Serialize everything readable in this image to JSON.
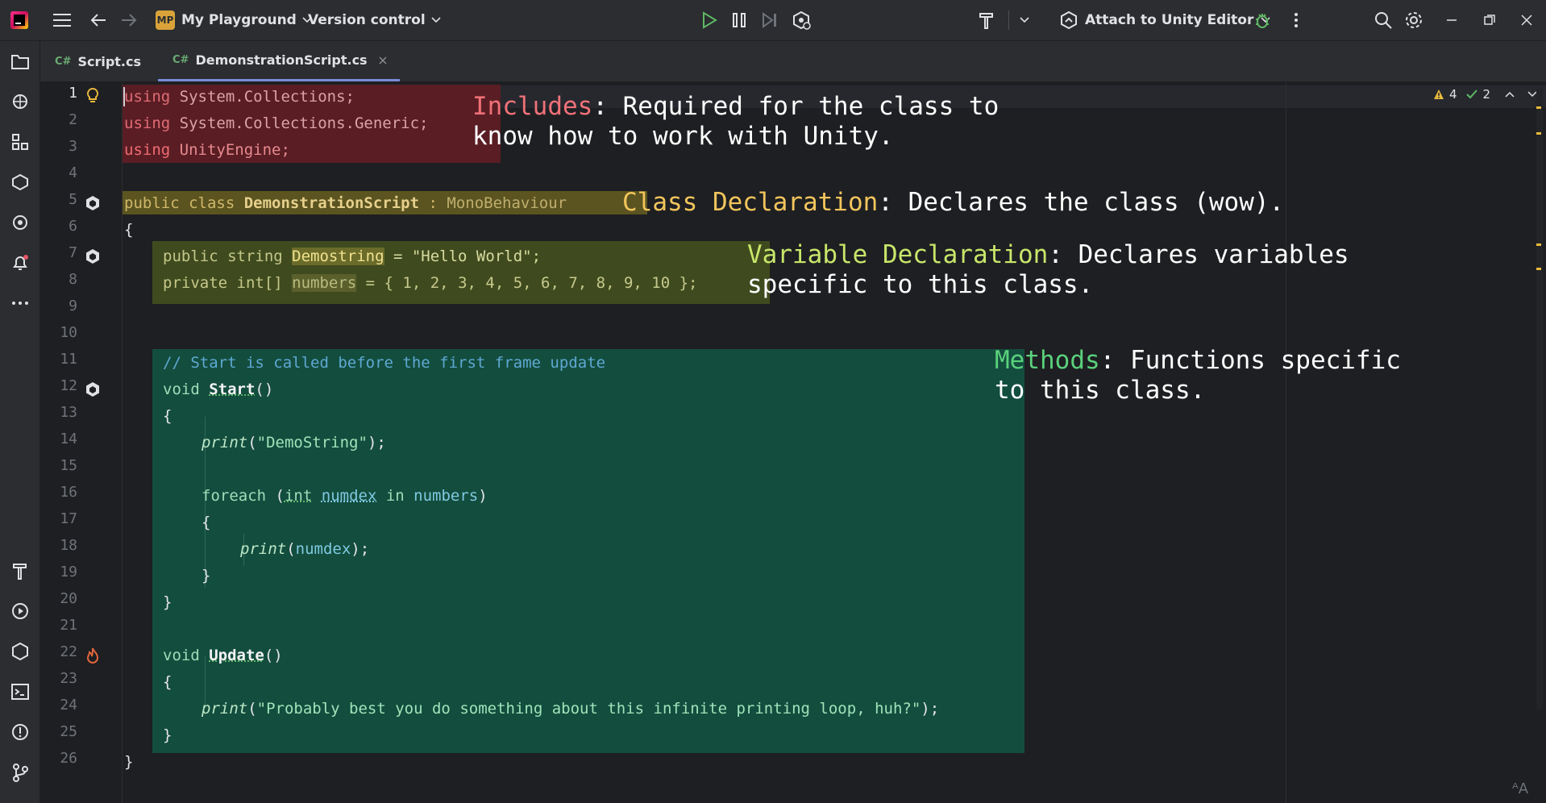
{
  "titlebar": {
    "project_badge": "MP",
    "project_name": "My Playground",
    "vcs_label": "Version control",
    "run_config": "Attach to Unity Editor"
  },
  "tabs": [
    {
      "type": "C#",
      "label": "Script.cs"
    },
    {
      "type": "C#",
      "label": "DemonstrationScript.cs"
    }
  ],
  "inspections": {
    "warnings": "4",
    "ok": "2"
  },
  "line_numbers": [
    "1",
    "2",
    "3",
    "4",
    "5",
    "6",
    "7",
    "8",
    "9",
    "10",
    "11",
    "12",
    "13",
    "14",
    "15",
    "16",
    "17",
    "18",
    "19",
    "20",
    "21",
    "22",
    "23",
    "24",
    "25",
    "26"
  ],
  "code": {
    "l1": {
      "kw": "using",
      "rest": " System.Collections;"
    },
    "l2": {
      "kw": "using",
      "rest": " System.Collections.Generic;"
    },
    "l3": {
      "kw": "using",
      "rest": " UnityEngine;"
    },
    "l5": {
      "a": "public class ",
      "name": "DemonstrationScript",
      "b": " : ",
      "base": "MonoBehaviour"
    },
    "l6": "{",
    "l7": {
      "a": "public string ",
      "var": "Demostring",
      "b": " = \"Hello World\";"
    },
    "l8": {
      "a": "private int[] ",
      "var": "numbers",
      "b": " = { 1, 2, 3, 4, 5, 6, 7, 8, 9, 10 };"
    },
    "l11": "// Start is called before the first frame update",
    "l12": {
      "kw": "void ",
      "name": "Start",
      "rest": "()"
    },
    "l13": "{",
    "l14": {
      "fn": "print",
      "a": "(",
      "str": "\"DemoString\"",
      "b": ");"
    },
    "l16": {
      "kw": "foreach ",
      "p1": "(",
      "t": "int",
      "sp": " ",
      "v": "numdex",
      "in": " in ",
      "col": "numbers",
      "p2": ")"
    },
    "l17": "{",
    "l18": {
      "fn": "print",
      "a": "(",
      "v": "numdex",
      "b": ");"
    },
    "l19": "}",
    "l20": "}",
    "l22": {
      "kw": "void ",
      "name": "Update",
      "rest": "()"
    },
    "l23": "{",
    "l24": {
      "fn": "print",
      "a": "(",
      "str": "\"Probably best you do something about this infinite printing loop, huh?\"",
      "b": ");"
    },
    "l25": "}",
    "l26": "}"
  },
  "annotations": {
    "includes": {
      "title": "Includes",
      "line1": ": Required for the class to",
      "line2": "know how to work with Unity."
    },
    "class_decl": {
      "title": "Class Declaration",
      "text": ": Declares the class (wow)."
    },
    "var_decl": {
      "title": "Variable Declaration",
      "line1": ": Declares variables",
      "line2": "specific to this class."
    },
    "methods": {
      "title": "Methods",
      "line1": ": Functions specific",
      "line2": "to this class."
    }
  },
  "colors": {
    "includes_box": "#5a1d24",
    "class_box": "#5b5420",
    "var_box": "#3f4b1e",
    "methods_box": "#134d3e",
    "includes_title": "#f07178",
    "class_title": "#f2c55c",
    "var_title": "#c8e66a",
    "methods_title": "#5ad17c"
  }
}
